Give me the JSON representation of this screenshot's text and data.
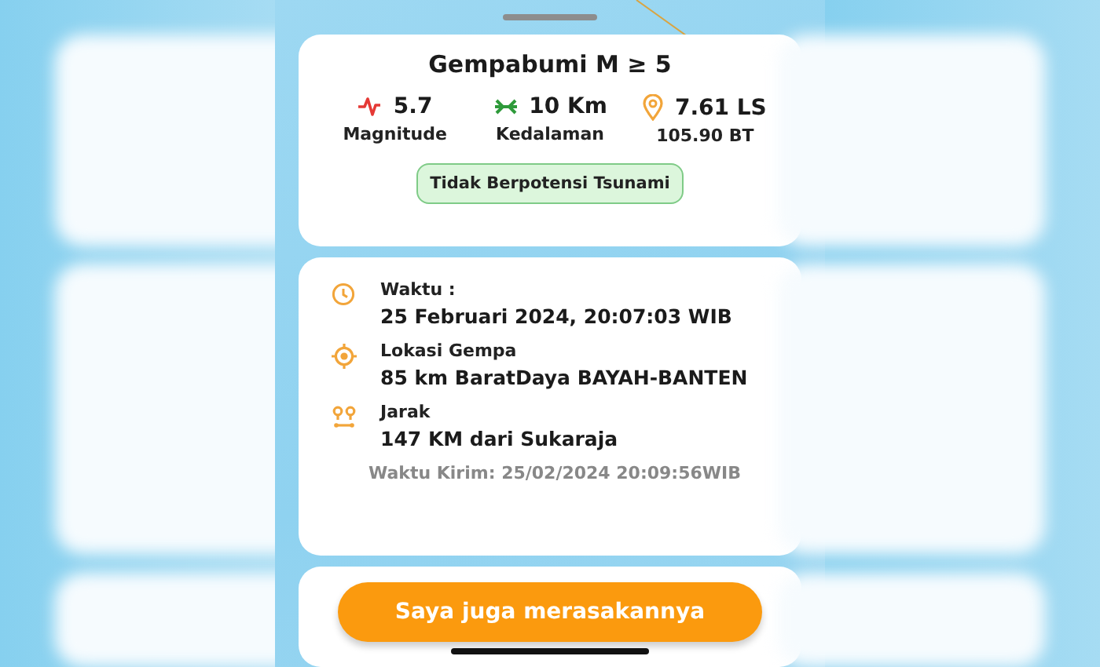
{
  "summary": {
    "title": "Gempabumi M ≥ 5",
    "stats": [
      {
        "kind": "magnitude",
        "value": "5.7",
        "label": "Magnitude"
      },
      {
        "kind": "depth",
        "value": "10 Km",
        "label": "Kedalaman"
      },
      {
        "kind": "location",
        "value": "7.61 LS",
        "label": "105.90 BT"
      }
    ],
    "tsunami_badge": "Tidak Berpotensi Tsunami"
  },
  "details": {
    "rows": [
      {
        "kind": "time",
        "label": "Waktu :",
        "value": "25 Februari 2024, 20:07:03 WIB"
      },
      {
        "kind": "epicenter",
        "label": "Lokasi Gempa",
        "value": "85 km BaratDaya BAYAH-BANTEN"
      },
      {
        "kind": "distance",
        "label": "Jarak",
        "value": "147 KM dari Sukaraja"
      }
    ],
    "sent_time": "Waktu Kirim: 25/02/2024 20:09:56WIB"
  },
  "action_button": "Saya juga merasakannya"
}
